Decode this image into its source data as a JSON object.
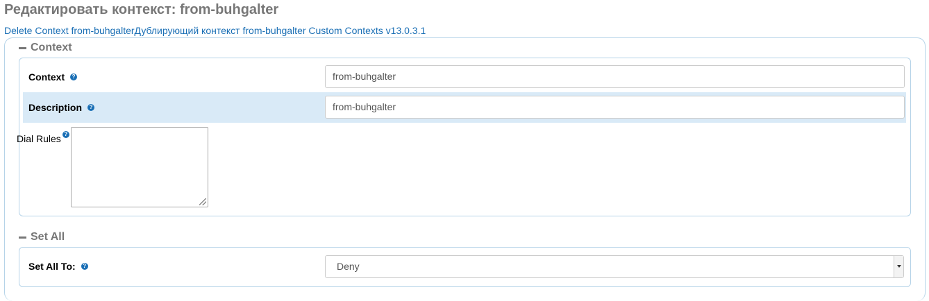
{
  "page_title": "Редактировать контекст: from-buhgalter",
  "links": {
    "delete": "Delete Context from-buhgalter",
    "duplicate": "Дублирующий контекст from-buhgalter",
    "custom": "Custom Contexts v13.0.3.1"
  },
  "context_section": {
    "title": "Context",
    "context_label": "Context",
    "context_value": "from-buhgalter",
    "description_label": "Description",
    "description_value": "from-buhgalter",
    "dial_rules_label": "Dial Rules",
    "dial_rules_value": ""
  },
  "set_all_section": {
    "title": "Set All",
    "set_all_label": "Set All To:",
    "set_all_value": "Deny"
  },
  "icons": {
    "help": "help-circle-icon",
    "collapse": "minus-icon",
    "dropdown": "chevron-down-icon"
  },
  "colors": {
    "link": "#1a6fb5",
    "highlight_row": "#d9eaf7",
    "border": "#b5d3e8",
    "heading": "#777777"
  }
}
